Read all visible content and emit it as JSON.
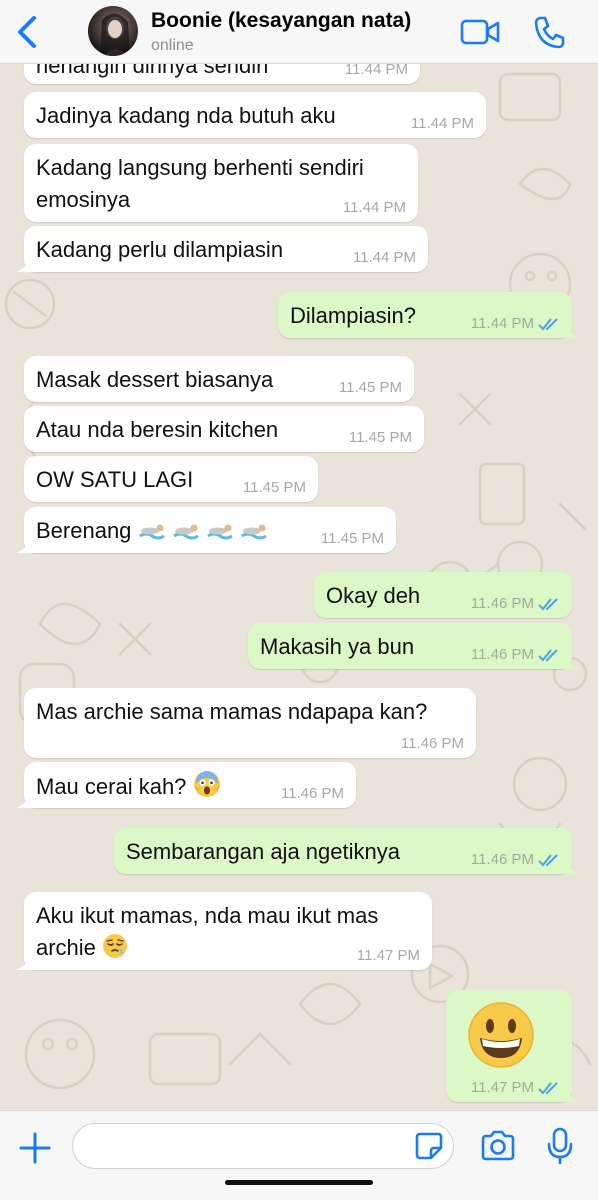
{
  "header": {
    "contact_name": "Boonie (kesayangan nata)",
    "status": "online",
    "icons": [
      "back-chevron-icon",
      "video-call-icon",
      "phone-call-icon"
    ],
    "accent_color": "#1a7cf5"
  },
  "messages": [
    {
      "dir": "in",
      "text": "nenangin dirinya sendiri",
      "time": "11.44 PM"
    },
    {
      "dir": "in",
      "text": "Jadinya kadang nda butuh aku",
      "time": "11.44 PM"
    },
    {
      "dir": "in",
      "text": "Kadang langsung berhenti sendiri",
      "text2": "emosinya",
      "time": "11.44 PM"
    },
    {
      "dir": "in",
      "text": "Kadang perlu dilampiasin",
      "time": "11.44 PM"
    },
    {
      "dir": "out",
      "text": "Dilampiasin?",
      "time": "11.44 PM"
    },
    {
      "dir": "in",
      "text": "Masak dessert biasanya",
      "time": "11.45 PM"
    },
    {
      "dir": "in",
      "text": "Atau nda beresin kitchen",
      "time": "11.45 PM"
    },
    {
      "dir": "in",
      "text": "OW SATU LAGI",
      "time": "11.45 PM"
    },
    {
      "dir": "in",
      "text": "Berenang",
      "emoji": "swimmer x4",
      "time": "11.45 PM"
    },
    {
      "dir": "out",
      "text": "Okay deh",
      "time": "11.46 PM"
    },
    {
      "dir": "out",
      "text": "Makasih ya bun",
      "time": "11.46 PM"
    },
    {
      "dir": "in",
      "text": "Mas archie sama mamas ndapapa kan?",
      "time": "11.46 PM"
    },
    {
      "dir": "in",
      "text": "Mau cerai kah?",
      "emoji": "screaming-face",
      "time": "11.46 PM"
    },
    {
      "dir": "out",
      "text": "Sembarangan aja ngetiknya",
      "time": "11.46 PM"
    },
    {
      "dir": "in",
      "text": "Aku ikut mamas, nda mau ikut mas",
      "text2": "archie",
      "emoji": "sleepy-face",
      "time": "11.47 PM"
    },
    {
      "dir": "out",
      "text": "",
      "emoji": "grinning-face",
      "time": "11.47 PM"
    }
  ],
  "colors": {
    "incoming_bubble": "#ffffff",
    "outgoing_bubble": "#dcf8c6",
    "read_ticks": "#4fa3e0",
    "chat_background": "#e9e3da"
  },
  "composer": {
    "placeholder": "",
    "icons": [
      "plus-icon",
      "sticker-icon",
      "camera-icon",
      "microphone-icon"
    ]
  }
}
